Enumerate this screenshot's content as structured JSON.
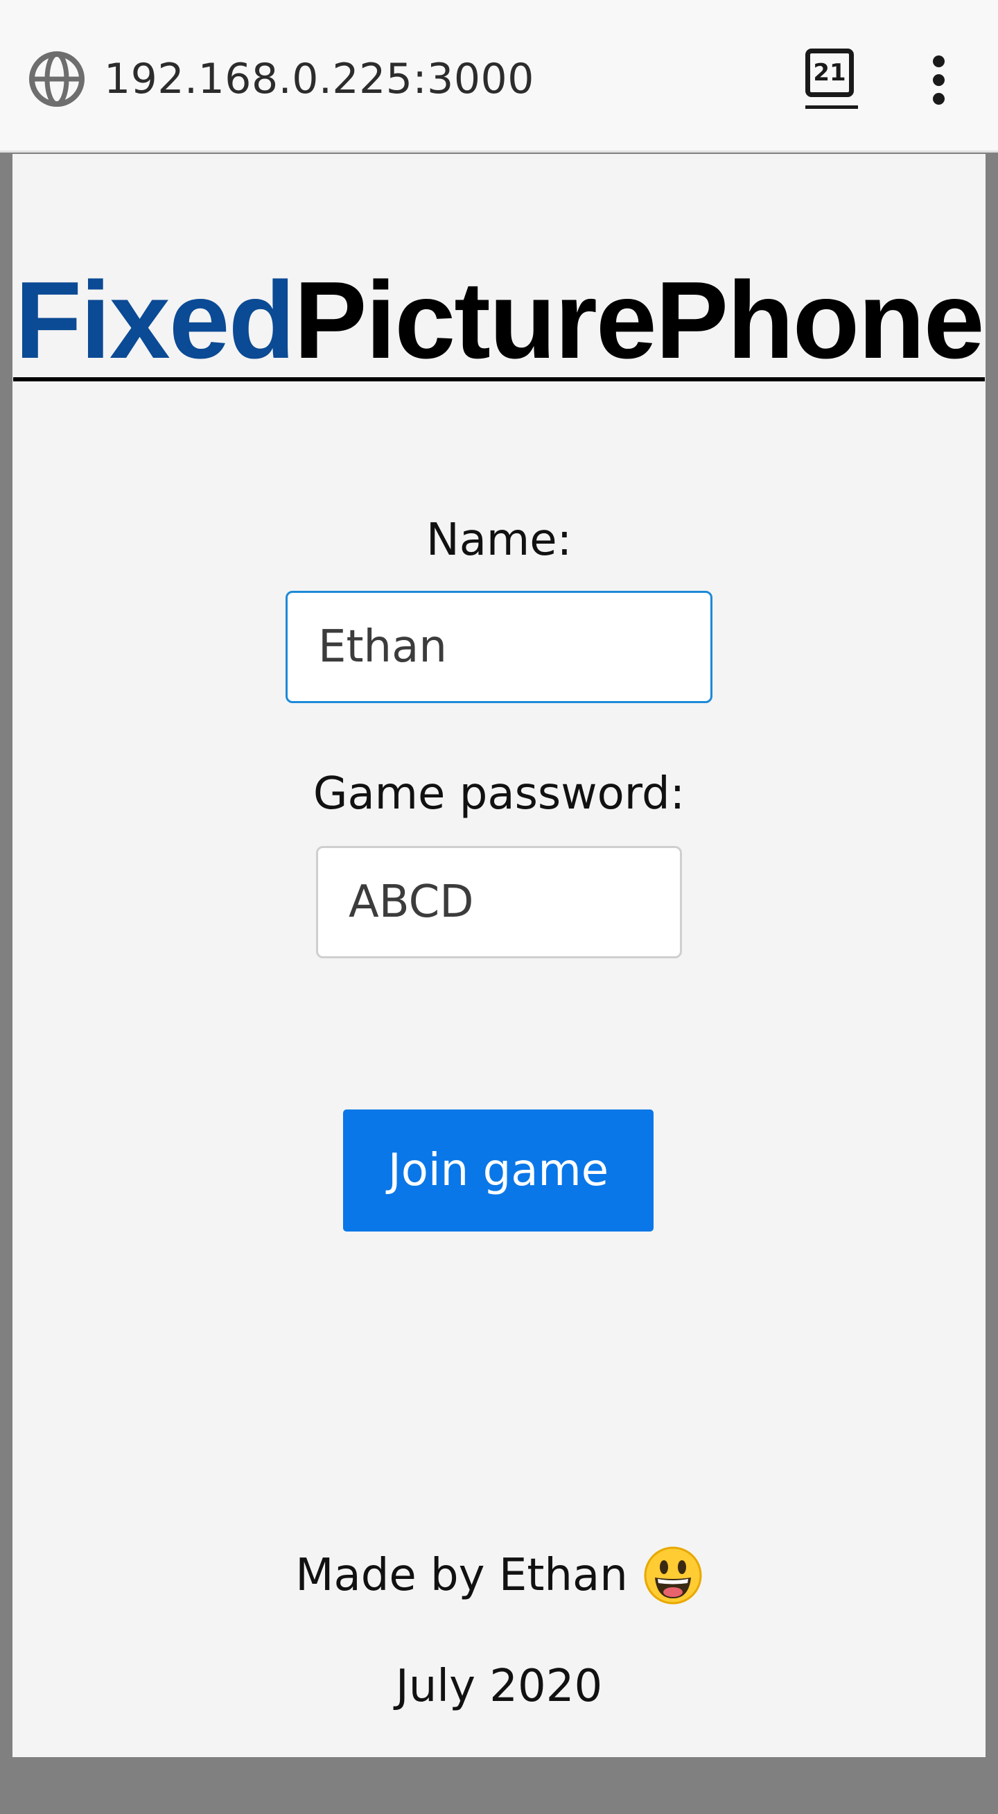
{
  "browser": {
    "url": "192.168.0.225:3000",
    "tab_count": "21",
    "icons": {
      "site_info": "globe-icon",
      "tabs": "tab-switcher-icon",
      "menu": "more-vert-icon"
    }
  },
  "header": {
    "title_part1": "Fixed",
    "title_part2": "PicturePhone",
    "title_part1_color": "#0b4a94",
    "title_part2_color": "#000000"
  },
  "form": {
    "name_label": "Name:",
    "name_value": "Ethan",
    "password_label": "Game password:",
    "password_value": "ABCD",
    "join_label": "Join game",
    "join_color": "#0a77e8"
  },
  "footer": {
    "made_by": "Made by Ethan",
    "emoji": "grinning-face-icon",
    "date": "July 2020"
  }
}
